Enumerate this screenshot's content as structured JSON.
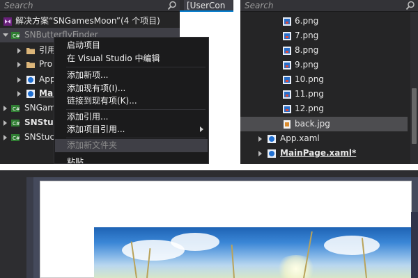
{
  "left_panel": {
    "search_placeholder": "Search",
    "solution_label": "解决方案“SNGamesMoon”(4 个项目)",
    "project_selected": "SNButterflyFinder",
    "children": [
      {
        "label": "引用",
        "icon": "folder-icon",
        "bold": false
      },
      {
        "label": "Pro",
        "icon": "folder-icon",
        "bold": false
      },
      {
        "label": "App",
        "icon": "xaml-icon",
        "bold": false
      },
      {
        "label": "Mai",
        "icon": "xaml-icon",
        "bold": true
      }
    ],
    "projects": [
      {
        "label": "SNGam",
        "bold": false
      },
      {
        "label": "SNStuc",
        "bold": true
      },
      {
        "label": "SNStuc",
        "bold": false
      }
    ]
  },
  "tab_strip": {
    "tab_label": "[UserCon"
  },
  "context_menu": {
    "items": [
      {
        "label": "启动项目",
        "disabled": false
      },
      {
        "label": "在 Visual Studio 中编辑",
        "disabled": false
      },
      {
        "label": "添加新项...",
        "disabled": false
      },
      {
        "label": "添加现有项(I)...",
        "disabled": false
      },
      {
        "label": "链接到现有项(K)...",
        "disabled": false
      },
      {
        "label": "添加引用...",
        "disabled": false
      },
      {
        "label": "添加项目引用...",
        "disabled": false,
        "submenu": true
      },
      {
        "label": "添加新文件夹",
        "disabled": true
      },
      {
        "label": "粘贴",
        "disabled": false
      }
    ]
  },
  "right_panel": {
    "search_placeholder": "Search",
    "files": [
      {
        "label": "6.png",
        "icon": "png-icon"
      },
      {
        "label": "7.png",
        "icon": "png-icon"
      },
      {
        "label": "8.png",
        "icon": "png-icon"
      },
      {
        "label": "9.png",
        "icon": "png-icon"
      },
      {
        "label": "10.png",
        "icon": "png-icon"
      },
      {
        "label": "11.png",
        "icon": "png-icon"
      },
      {
        "label": "12.png",
        "icon": "png-icon"
      },
      {
        "label": "back.jpg",
        "icon": "jpg-icon",
        "selected": true
      }
    ],
    "xaml_items": [
      {
        "label": "App.xaml",
        "bold": false
      },
      {
        "label": "MainPage.xaml*",
        "bold": true
      }
    ]
  },
  "colors": {
    "panel_bg": "#252526",
    "menu_bg": "#1b1b1c",
    "selection": "#3f3f46",
    "accent": "#007acc"
  }
}
